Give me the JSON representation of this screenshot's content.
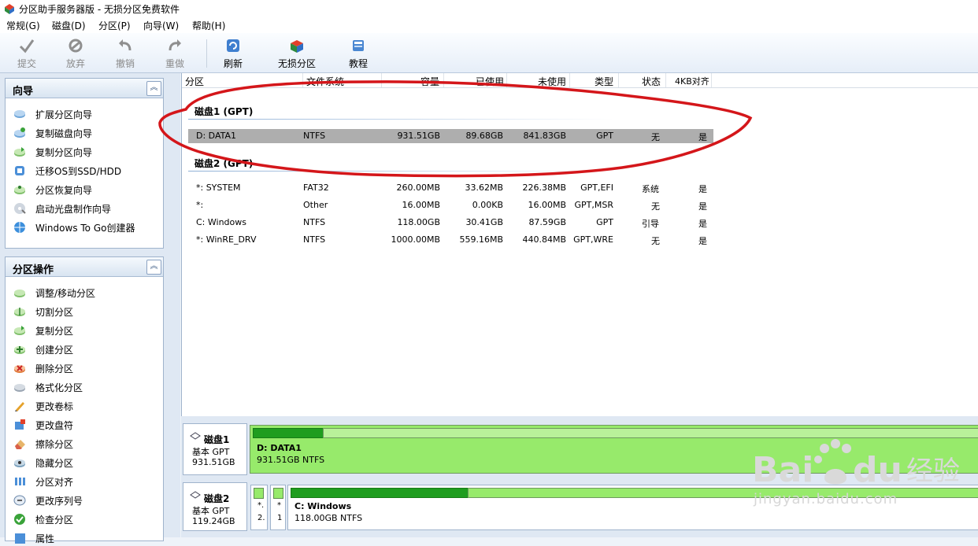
{
  "window": {
    "title": "分区助手服务器版 - 无损分区免费软件"
  },
  "menu": [
    "常规(G)",
    "磁盘(D)",
    "分区(P)",
    "向导(W)",
    "帮助(H)"
  ],
  "toolbar": {
    "submit": "提交",
    "discard": "放弃",
    "undo": "撤销",
    "redo": "重做",
    "refresh": "刷新",
    "lossless": "无损分区",
    "tutorial": "教程"
  },
  "wizard_panel": {
    "title": "向导",
    "items": [
      "扩展分区向导",
      "复制磁盘向导",
      "复制分区向导",
      "迁移OS到SSD/HDD",
      "分区恢复向导",
      "启动光盘制作向导",
      "Windows To Go创建器"
    ]
  },
  "ops_panel": {
    "title": "分区操作",
    "items": [
      "调整/移动分区",
      "切割分区",
      "复制分区",
      "创建分区",
      "删除分区",
      "格式化分区",
      "更改卷标",
      "更改盘符",
      "擦除分区",
      "隐藏分区",
      "分区对齐",
      "更改序列号",
      "检查分区",
      "属性"
    ]
  },
  "columns": [
    "分区",
    "文件系统",
    "容量",
    "已使用",
    "未使用",
    "类型",
    "状态",
    "4KB对齐"
  ],
  "disks": [
    {
      "title": "磁盘1 (GPT)",
      "rows": [
        [
          "D: DATA1",
          "NTFS",
          "931.51GB",
          "89.68GB",
          "841.83GB",
          "GPT",
          "无",
          "是"
        ]
      ]
    },
    {
      "title": "磁盘2 (GPT)",
      "rows": [
        [
          "*: SYSTEM",
          "FAT32",
          "260.00MB",
          "33.62MB",
          "226.38MB",
          "GPT,EFI",
          "系统",
          "是"
        ],
        [
          "*:",
          "Other",
          "16.00MB",
          "0.00KB",
          "16.00MB",
          "GPT,MSR",
          "无",
          "是"
        ],
        [
          "C: Windows",
          "NTFS",
          "118.00GB",
          "30.41GB",
          "87.59GB",
          "GPT",
          "引导",
          "是"
        ],
        [
          "*: WinRE_DRV",
          "NTFS",
          "1000.00MB",
          "559.16MB",
          "440.84MB",
          "GPT,WRE",
          "无",
          "是"
        ]
      ]
    }
  ],
  "disk_map": {
    "disk1": {
      "name": "磁盘1",
      "type": "基本 GPT",
      "size": "931.51GB",
      "partition_name": "D: DATA1",
      "partition_info": "931.51GB NTFS",
      "used_fraction": 0.096
    },
    "disk2": {
      "name": "磁盘2",
      "type": "基本 GPT",
      "size": "119.24GB",
      "mini1_line1": "*.",
      "mini1_line2": "2.",
      "mini2_line1": "*",
      "mini2_line2": "1",
      "partition_name": "C: Windows",
      "partition_info": "118.00GB NTFS",
      "used_fraction": 0.258
    }
  },
  "watermark": {
    "text": "jingyan.baidu.com"
  },
  "colors": {
    "partition_fill": "#97ea6b",
    "used_fill": "#1f9d1f",
    "selected_row": "#aeaeae",
    "annotation": "#d4161a"
  }
}
